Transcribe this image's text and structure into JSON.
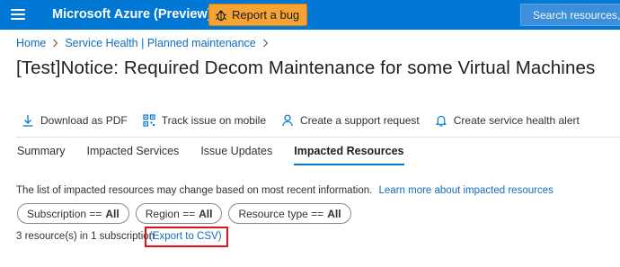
{
  "topbar": {
    "brand": "Microsoft Azure (Preview)",
    "report_bug_label": "Report a bug",
    "search_placeholder": "Search resources, services, and docs",
    "color": "#0078d4"
  },
  "breadcrumb": {
    "items": [
      "Home",
      "Service Health | Planned maintenance"
    ]
  },
  "page": {
    "title": "[Test]Notice: Required Decom Maintenance for some Virtual Machines"
  },
  "commands": [
    {
      "label": "Download as PDF",
      "icon": "download-icon"
    },
    {
      "label": "Track issue on mobile",
      "icon": "qr-code-icon"
    },
    {
      "label": "Create a support request",
      "icon": "person-icon"
    },
    {
      "label": "Create service health alert",
      "icon": "bell-icon"
    }
  ],
  "tabs": [
    {
      "label": "Summary",
      "active": false
    },
    {
      "label": "Impacted Services",
      "active": false
    },
    {
      "label": "Issue Updates",
      "active": false
    },
    {
      "label": "Impacted Resources",
      "active": true
    }
  ],
  "info": {
    "text": "The list of impacted resources may change based on most recent information.",
    "link": "Learn more about impacted resources"
  },
  "filters": [
    {
      "label": "Subscription ==",
      "value": "All"
    },
    {
      "label": "Region ==",
      "value": "All"
    },
    {
      "label": "Resource type ==",
      "value": "All"
    }
  ],
  "results": {
    "count_text": "3 resource(s) in 1 subscription",
    "export_link": "(Export to CSV)",
    "highlight_color": "#e3101b"
  }
}
